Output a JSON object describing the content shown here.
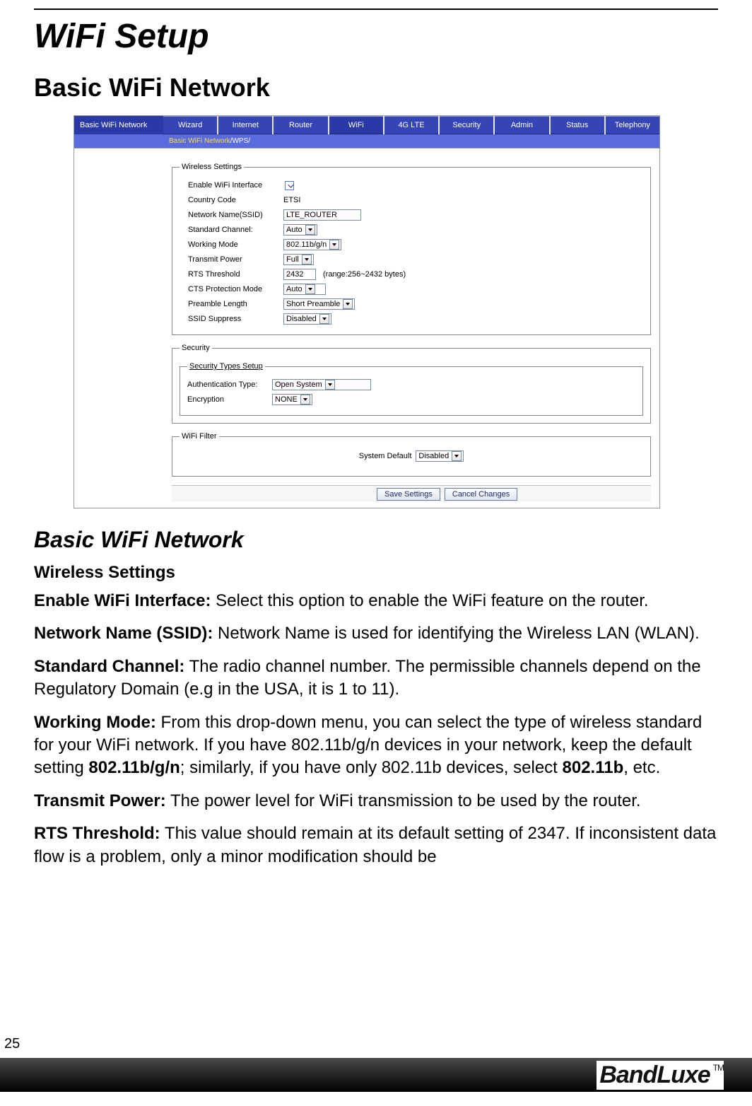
{
  "page": {
    "title": "WiFi Setup",
    "section": "Basic WiFi Network",
    "section2": "Basic WiFi Network",
    "h3": "Wireless Settings",
    "number": "25",
    "brand": "BandLuxe",
    "tm": "TM"
  },
  "router": {
    "side_title": "Basic WiFi Network",
    "tabs": [
      "Wizard",
      "Internet",
      "Router",
      "WiFi",
      "4G LTE",
      "Security",
      "Admin",
      "Status",
      "Telephony"
    ],
    "active_tab": "WiFi",
    "breadcrumb": {
      "active": "Basic WiFi Network",
      "sep": " / ",
      "next": "WPS",
      "tail": " /"
    },
    "wireless": {
      "legend": "Wireless Settings",
      "enable_label": "Enable WiFi Interface",
      "country_label": "Country Code",
      "country_value": "ETSI",
      "ssid_label": "Network Name(SSID)",
      "ssid_value": "LTE_ROUTER",
      "channel_label": "Standard Channel:",
      "channel_value": "Auto",
      "mode_label": "Working Mode",
      "mode_value": "802.11b/g/n",
      "tx_label": "Transmit Power",
      "tx_value": "Full",
      "rts_label": "RTS Threshold",
      "rts_value": "2432",
      "rts_hint": "(range:256~2432 bytes)",
      "cts_label": "CTS Protection Mode",
      "cts_value": "Auto",
      "preamble_label": "Preamble Length",
      "preamble_value": "Short Preamble",
      "ssh_label": "SSID Suppress",
      "ssh_value": "Disabled"
    },
    "security": {
      "legend": "Security",
      "inner_legend": "Security Types Setup",
      "auth_label": "Authentication Type:",
      "auth_value": "Open System",
      "enc_label": "Encryption",
      "enc_value": "NONE"
    },
    "filter": {
      "legend": "WiFi Filter",
      "label": "System Default",
      "value": "Disabled"
    },
    "buttons": {
      "save": "Save Settings",
      "cancel": "Cancel Changes"
    }
  },
  "body": {
    "p1a": "Enable WiFi Interface:",
    "p1b": " Select this option to enable the WiFi feature on the router.",
    "p2a": "Network Name (SSID):",
    "p2b": " Network Name is used for identifying the Wireless LAN (WLAN).",
    "p3a": "Standard Channel:",
    "p3b": " The radio channel number. The permissible channels depend on the Regulatory Domain (e.g in the USA, it is 1 to 11).",
    "p4a": "Working Mode:",
    "p4b": " From this drop-down menu, you can select the type of wireless standard for your WiFi network. If you have 802.11b/g/n devices in your network, keep the default setting ",
    "p4c": "802.11b/g/n",
    "p4d": "; similarly, if you have only 802.11b devices, select ",
    "p4e": "802.11b",
    "p4f": ", etc.",
    "p5a": "Transmit Power:",
    "p5b": " The power level for WiFi transmission to be used by the router.",
    "p6a": "RTS Threshold:",
    "p6b": " This value should remain at its default setting of 2347. If inconsistent data flow is a problem, only a minor modification should be"
  }
}
